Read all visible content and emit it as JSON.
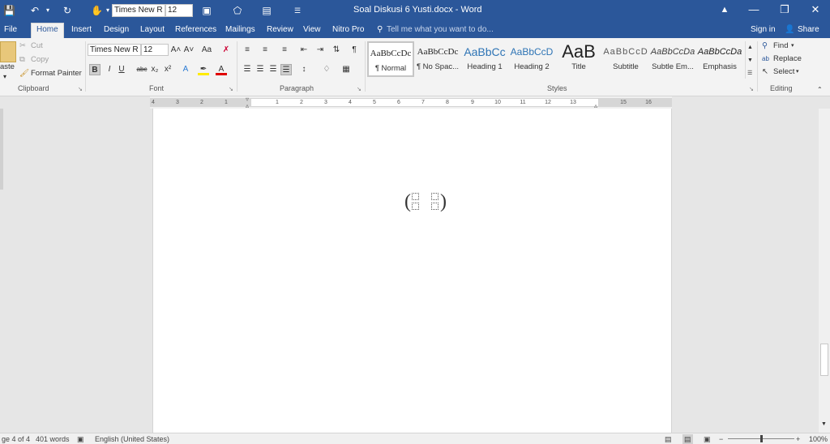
{
  "titlebar": {
    "title": "Soal Diskusi 6 Yusti.docx - Word",
    "font_name": "Times New R",
    "font_size": "12",
    "color": "#2b579a"
  },
  "tabs": {
    "file": "File",
    "home": "Home",
    "insert": "Insert",
    "design": "Design",
    "layout": "Layout",
    "references": "References",
    "mailings": "Mailings",
    "review": "Review",
    "view": "View",
    "nitro": "Nitro Pro",
    "tell_me": "Tell me what you want to do...",
    "sign_in": "Sign in",
    "share": "Share"
  },
  "clipboard": {
    "paste": "aste",
    "cut": "Cut",
    "copy": "Copy",
    "format_painter": "Format Painter",
    "label": "Clipboard"
  },
  "font": {
    "name": "Times New R",
    "size": "12",
    "bold": "B",
    "italic": "I",
    "underline": "U",
    "strike": "abc",
    "subscript": "x₂",
    "superscript": "x²",
    "grow": "A˄",
    "shrink": "A˅",
    "change_case": "Aa",
    "font_color": "A",
    "label": "Font"
  },
  "paragraph": {
    "pilcrow": "¶",
    "label": "Paragraph"
  },
  "styles": {
    "label": "Styles",
    "items": [
      {
        "sample": "AaBbCcDc",
        "name": "¶ Normal"
      },
      {
        "sample": "AaBbCcDc",
        "name": "¶ No Spac..."
      },
      {
        "sample": "AaBbCc",
        "name": "Heading 1"
      },
      {
        "sample": "AaBbCcD",
        "name": "Heading 2"
      },
      {
        "sample": "AaB",
        "name": "Title"
      },
      {
        "sample": "AaBbCcD",
        "name": "Subtitle"
      },
      {
        "sample": "AaBbCcDa",
        "name": "Subtle Em..."
      },
      {
        "sample": "AaBbCcDa",
        "name": "Emphasis"
      }
    ]
  },
  "editing": {
    "find": "Find",
    "replace": "Replace",
    "select": "Select",
    "label": "Editing"
  },
  "ruler": {
    "ticks": [
      "4",
      "3",
      "2",
      "1",
      "1",
      "2",
      "3",
      "4",
      "5",
      "6",
      "7",
      "8",
      "9",
      "10",
      "11",
      "12",
      "13",
      "15",
      "16"
    ]
  },
  "document": {
    "equation": "( ⬚ ⬚ )"
  },
  "status": {
    "page": "ge 4 of 4",
    "words": "401 words",
    "language": "English (United States)",
    "zoom": "100%"
  }
}
